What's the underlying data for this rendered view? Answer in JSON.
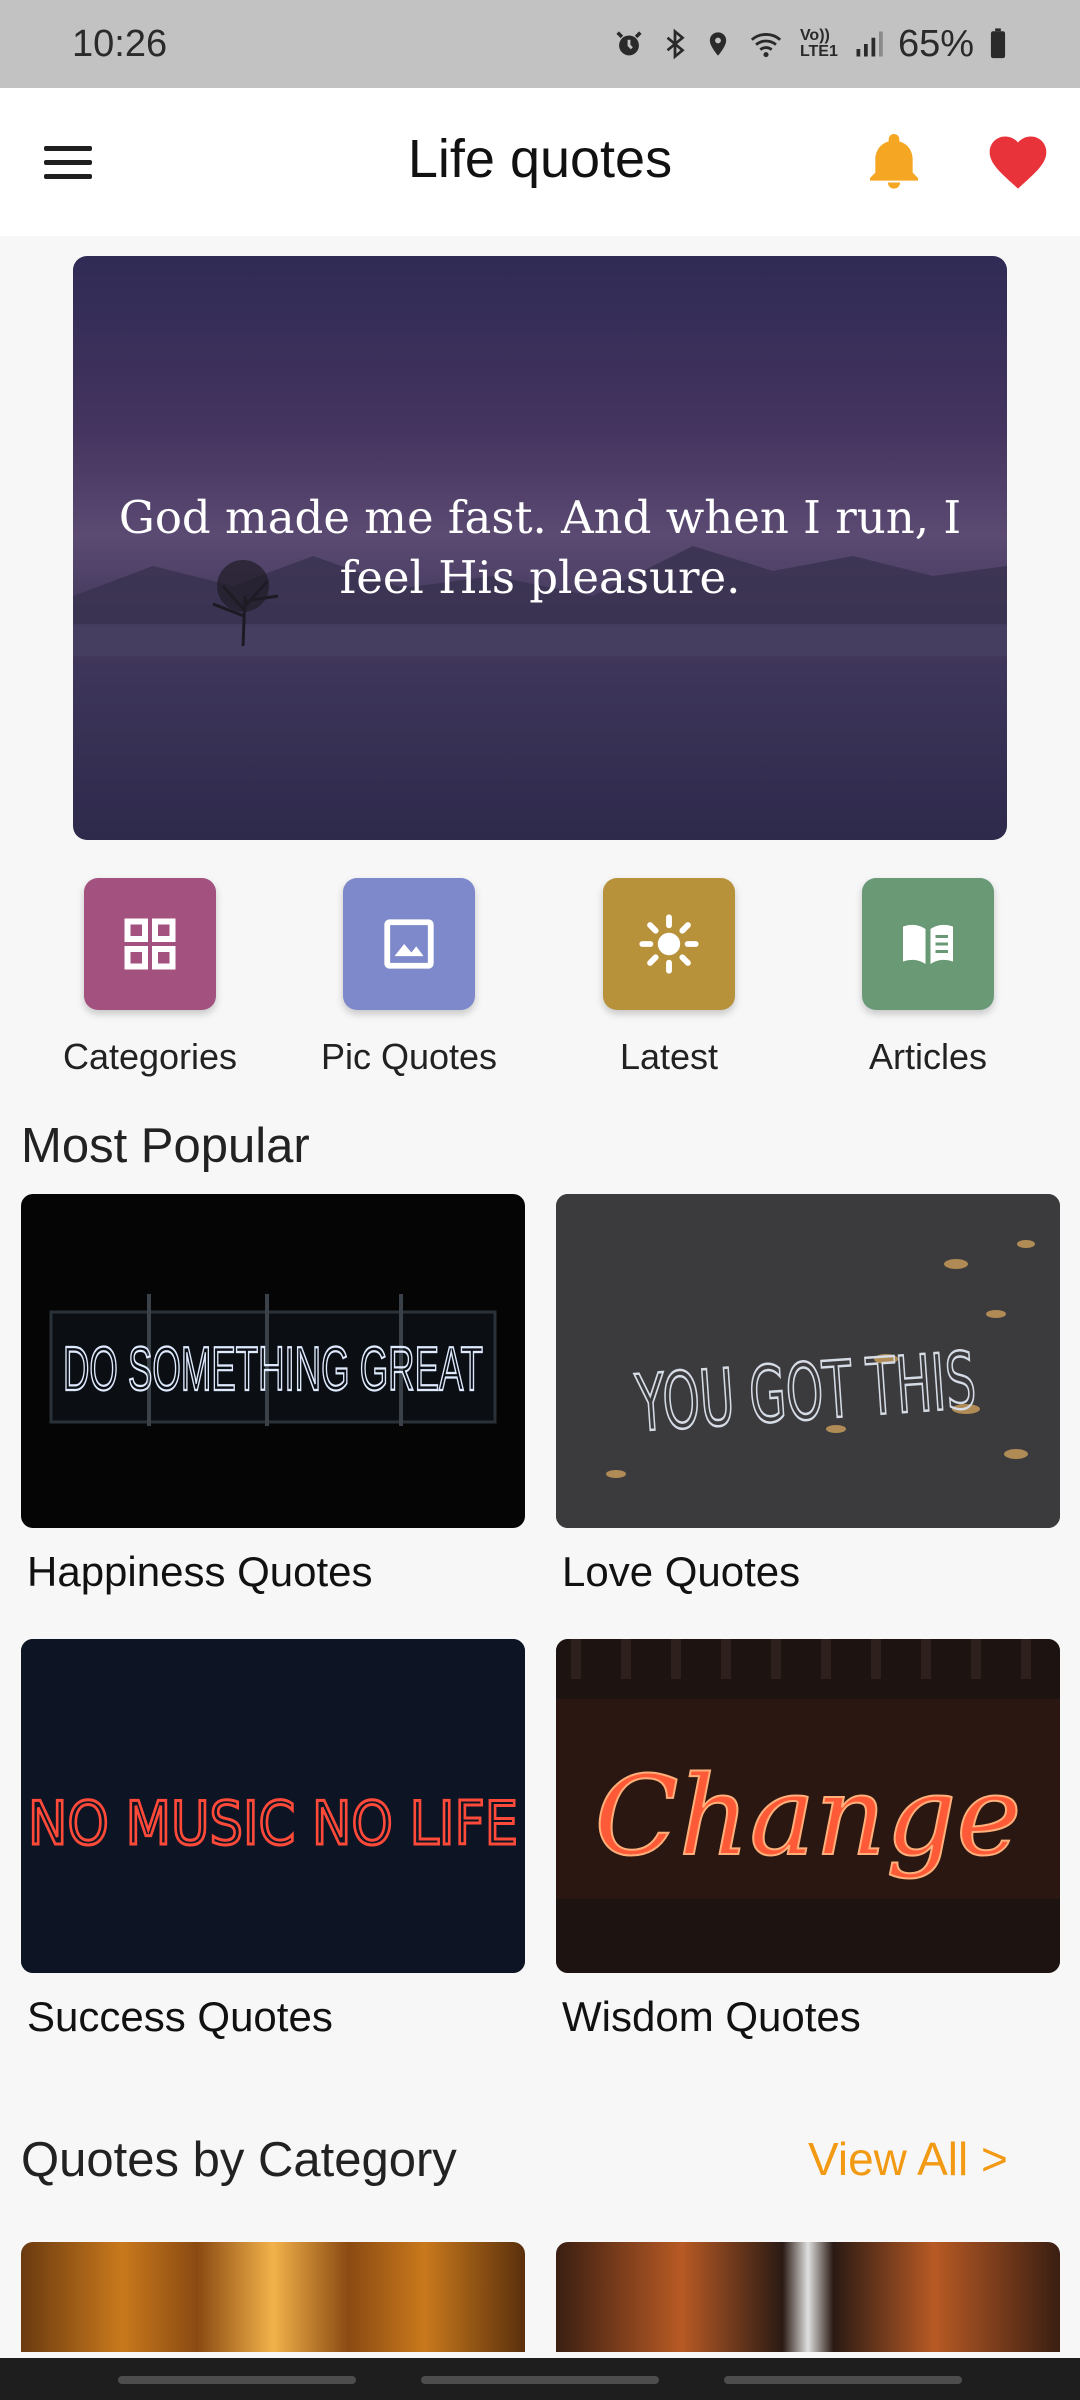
{
  "status_bar": {
    "time": "10:26",
    "battery": "65%",
    "network": "Vo)) LTE1"
  },
  "app_bar": {
    "title": "Life quotes"
  },
  "hero": {
    "quote": "God made me fast. And when I run, I feel His pleasure."
  },
  "shortcuts": [
    {
      "label": "Categories",
      "color": "#a3527f",
      "icon": "grid-icon"
    },
    {
      "label": "Pic Quotes",
      "color": "#7d89ca",
      "icon": "image-icon"
    },
    {
      "label": "Latest",
      "color": "#b8923a",
      "icon": "sun-icon"
    },
    {
      "label": "Articles",
      "color": "#6a9975",
      "icon": "book-icon"
    }
  ],
  "most_popular": {
    "title": "Most Popular",
    "cards": [
      {
        "caption": "Happiness Quotes",
        "image_text": "DO SOMETHING GREAT"
      },
      {
        "caption": "Love Quotes",
        "image_text": "YOU GOT THIS"
      },
      {
        "caption": "Success Quotes",
        "image_text": "NO MUSIC NO LIFE"
      },
      {
        "caption": "Wisdom Quotes",
        "image_text": "Change"
      }
    ]
  },
  "by_category": {
    "title": "Quotes by Category",
    "view_all": "View All >"
  },
  "colors": {
    "accent": "#f39a15",
    "heart": "#e8333a",
    "bell": "#f5a623"
  }
}
